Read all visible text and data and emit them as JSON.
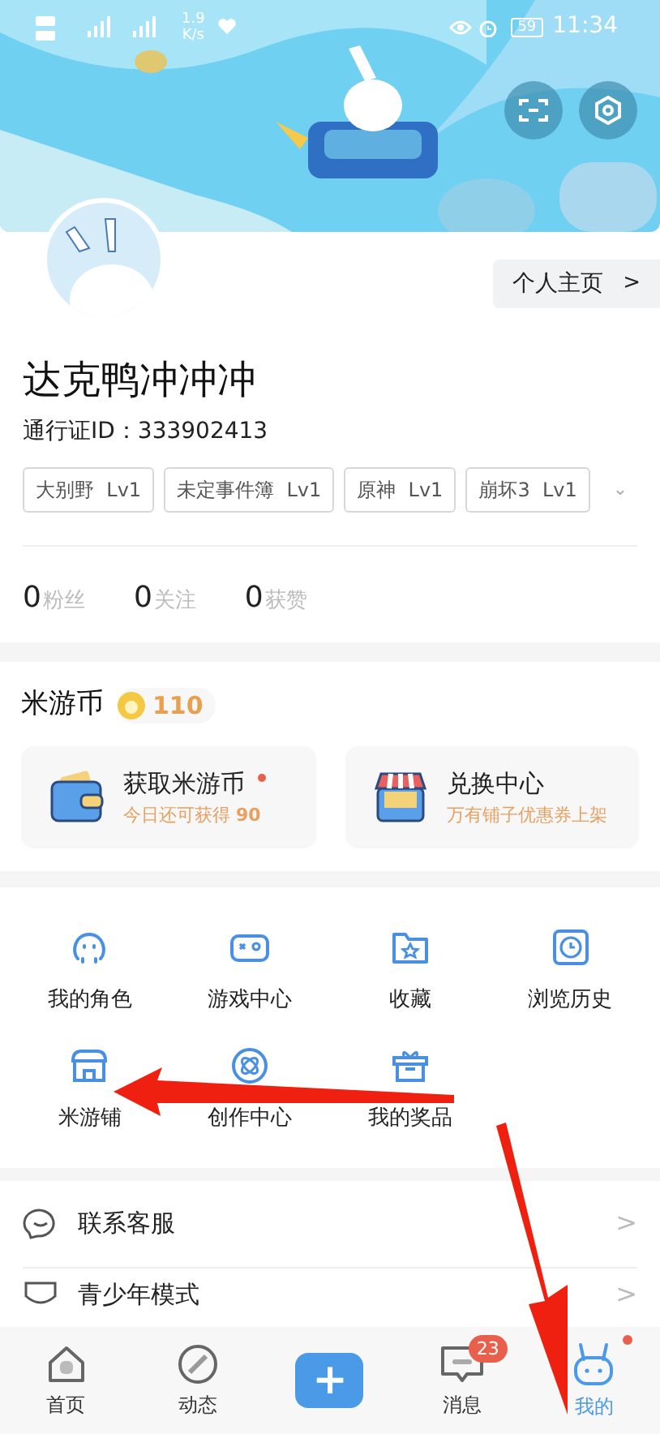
{
  "status_bar": {
    "speed": "1.9",
    "speed_unit": "K/s",
    "battery": "59",
    "time": "11:34"
  },
  "profile": {
    "home_button": "个人主页",
    "chevron": ">",
    "name": "达克鸭冲冲冲",
    "pass_id": "通行证ID：333902413",
    "tags": [
      {
        "game": "大别野",
        "level": "Lv1"
      },
      {
        "game": "未定事件簿",
        "level": "Lv1"
      },
      {
        "game": "原神",
        "level": "Lv1"
      },
      {
        "game": "崩坏3",
        "level": "Lv1"
      }
    ],
    "more": "⌄",
    "stats": [
      {
        "value": "0",
        "label": "粉丝"
      },
      {
        "value": "0",
        "label": "关注"
      },
      {
        "value": "0",
        "label": "获赞"
      }
    ]
  },
  "coins": {
    "title": "米游币",
    "balance": "110",
    "cards": [
      {
        "kind": "wallet",
        "title": "获取米游币",
        "subtitle": "今日还可获得 **90**",
        "dot": true
      },
      {
        "kind": "shop",
        "title": "兑换中心",
        "subtitle": "万有铺子优惠券上架",
        "dot": false
      }
    ]
  },
  "features": [
    {
      "kind": "character",
      "label": "我的角色"
    },
    {
      "kind": "gamepad",
      "label": "游戏中心"
    },
    {
      "kind": "folder",
      "label": "收藏"
    },
    {
      "kind": "clock",
      "label": "浏览历史"
    },
    {
      "kind": "store",
      "label": "米游铺"
    },
    {
      "kind": "atom",
      "label": "创作中心"
    },
    {
      "kind": "gift",
      "label": "我的奖品"
    }
  ],
  "menu": [
    {
      "kind": "chat",
      "label": "联系客服",
      "chevron": ">"
    },
    {
      "kind": "mask",
      "label": "青少年模式",
      "chevron": ">"
    }
  ],
  "bottom_nav": [
    {
      "kind": "home",
      "label": "首页",
      "selected": false
    },
    {
      "kind": "compass",
      "label": "动态",
      "selected": false
    },
    {
      "kind": "plus",
      "label": "+",
      "selected": false
    },
    {
      "kind": "message",
      "label": "消息",
      "selected": false,
      "badge": "23"
    },
    {
      "kind": "bunny",
      "label": "我的",
      "selected": true,
      "dot": true
    }
  ]
}
